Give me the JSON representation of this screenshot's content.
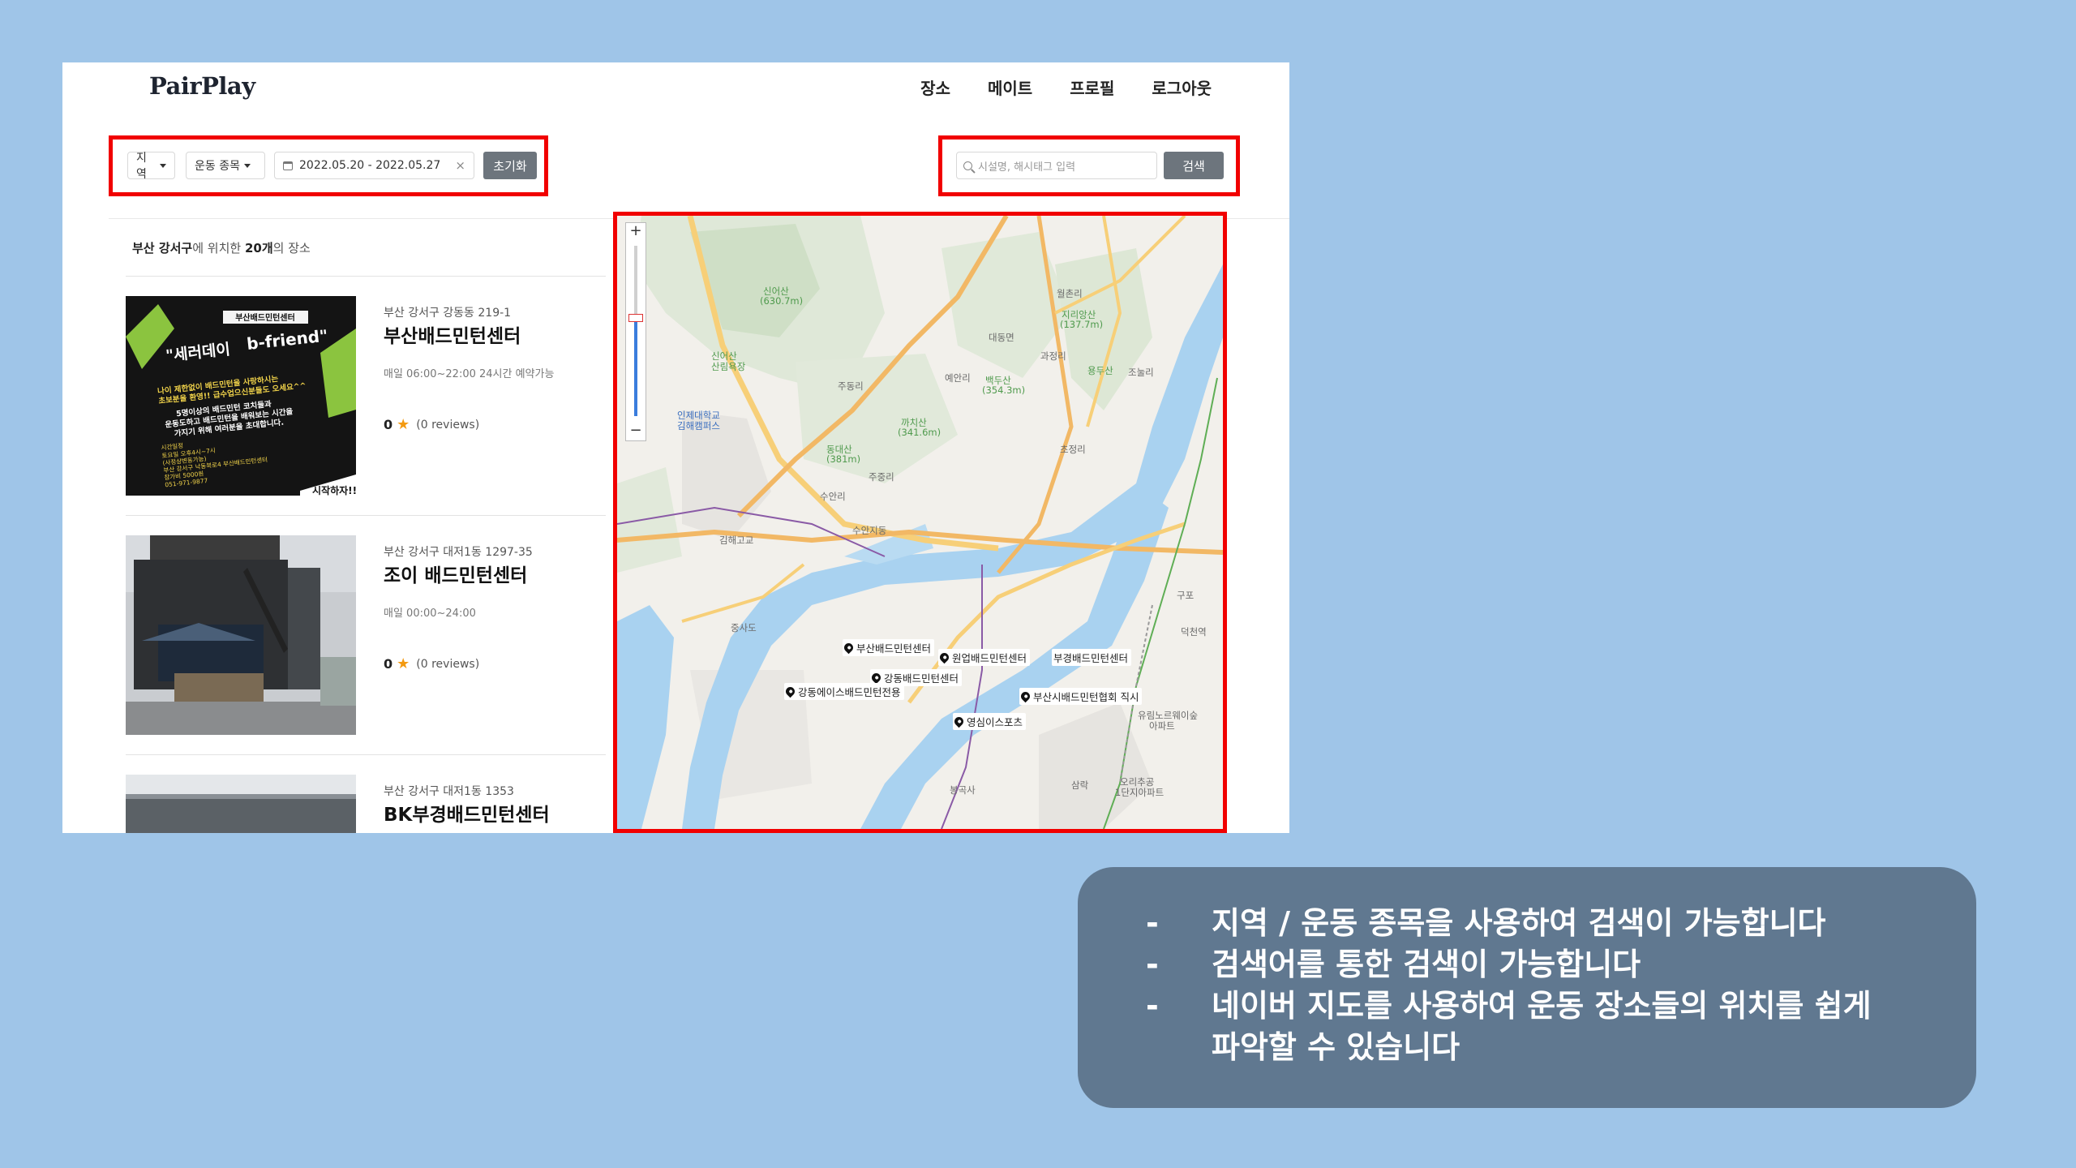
{
  "app": {
    "logo": "PairPlay",
    "nav": [
      "장소",
      "메이트",
      "프로필",
      "로그아웃"
    ]
  },
  "filters": {
    "region": "지역",
    "sport": "운동 종목",
    "date_range": "2022.05.20 - 2022.05.27",
    "clear_symbol": "×",
    "reset": "초기화"
  },
  "search": {
    "placeholder": "시설명, 해시태그 입력",
    "button": "검색"
  },
  "summary": {
    "region": "부산 강서구",
    "mid": "에 위치한 ",
    "count": "20개",
    "end": "의 장소"
  },
  "places": [
    {
      "address": "부산 강서구 강동동 219-1",
      "name": "부산배드민턴센터",
      "hours": "매일 06:00~22:00 24시간 예약가능",
      "rating": "0",
      "reviews": "(0 reviews)",
      "poster": {
        "badge": "부산배드민턴센터",
        "headline": "\"세러데이",
        "brand": "b-friend\"",
        "lines": [
          "나이 제한없이 배드민턴을 사랑하시는",
          "초보분을 환영!! 급수업으신분들도 오세요^^",
          "5명이상의 배드민턴 코치들과",
          "운동도하고 배드민턴을 배워보는 시간을",
          "가지기 위해 여러분을 초대합니다."
        ],
        "footer": [
          "시간일정",
          "토요일 오후4시~7시",
          "(사정상변동가능)",
          "부산 강서구 낙동북로4 부산배드민턴센터",
          "참가비 5000원",
          "051-971-9877"
        ],
        "corner": "시작하자!!"
      }
    },
    {
      "address": "부산 강서구 대저1동 1297-35",
      "name": "조이 배드민턴센터",
      "hours": "매일 00:00~24:00",
      "rating": "0",
      "reviews": "(0 reviews)"
    },
    {
      "address": "부산 강서구 대저1동 1353",
      "name": "BK부경배드민턴센터"
    }
  ],
  "map": {
    "zoom_in": "+",
    "zoom_out": "−",
    "markers": [
      "부산배드민턴센터",
      "원업배드민턴센터",
      "부경배드민턴센터",
      "강동배드민턴센터",
      "부산시배드민턴협회 직시",
      "강동에이스배드민턴전용",
      "영심이스포츠"
    ],
    "labels": [
      "신어산",
      "(630.7m)",
      "신어산",
      "산림욕장",
      "인제대학교",
      "김해캠퍼스",
      "대동면",
      "주동리",
      "예안리",
      "백두산",
      "(354.3m)",
      "까치산",
      "(341.6m)",
      "동대산",
      "(381m)",
      "주중리",
      "수안리",
      "조눌리",
      "초정리",
      "지리앙산",
      "(137.7m)",
      "월촌리",
      "용두산",
      "과정리",
      "수안지동",
      "중사도",
      "유림노르웨이숲",
      "아파트",
      "오리추공",
      "1단지아파트",
      "덕천역",
      "구포",
      "삼락",
      "김해고교",
      "봉곡사"
    ]
  },
  "notes": [
    "지역 / 운동 종목을 사용하여 검색이 가능합니다",
    "검색어를 통한 검색이 가능합니다",
    "네이버 지도를 사용하여 운동 장소들의 위치를 쉽게 파악할 수 있습니다"
  ]
}
